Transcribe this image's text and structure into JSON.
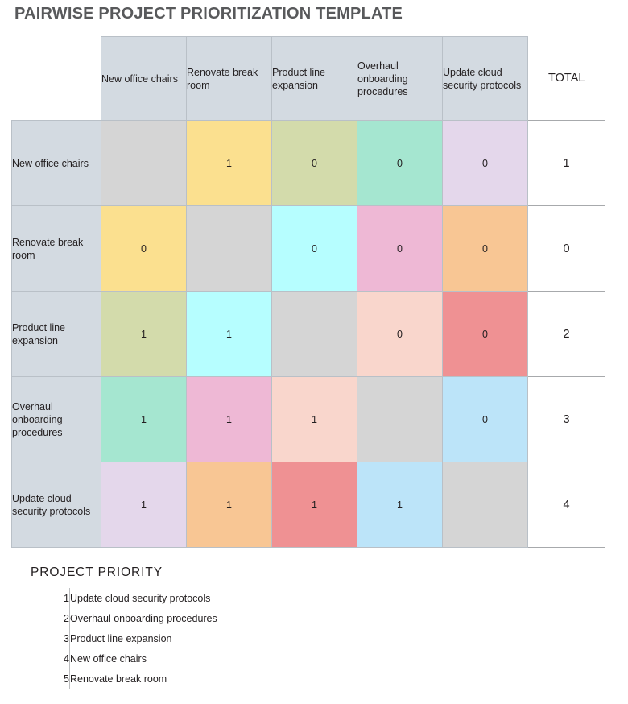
{
  "title": "PAIRWISE PROJECT PRIORITIZATION TEMPLATE",
  "matrix": {
    "total_header": "TOTAL",
    "projects": [
      "New office chairs",
      "Renovate break room",
      "Product line expansion",
      "Overhaul onboarding procedures",
      "Update cloud security protocols"
    ],
    "column_headers": [
      "New office chairs",
      "Renovate break room",
      "Product line expansion",
      "Overhaul onboarding procedures",
      "Update cloud security protocols"
    ],
    "rows": [
      {
        "label": "New office chairs",
        "cells": [
          {
            "value": "",
            "color": "#d5d5d5",
            "diagonal": true
          },
          {
            "value": "1",
            "color": "#fbe08f",
            "diagonal": false
          },
          {
            "value": "0",
            "color": "#d3dbab",
            "diagonal": false
          },
          {
            "value": "0",
            "color": "#a5e6d0",
            "diagonal": false
          },
          {
            "value": "0",
            "color": "#e4d7eb",
            "diagonal": false
          }
        ],
        "total": "1"
      },
      {
        "label": "Renovate break room",
        "cells": [
          {
            "value": "0",
            "color": "#fbe08f",
            "diagonal": false
          },
          {
            "value": "",
            "color": "#d5d5d5",
            "diagonal": true
          },
          {
            "value": "0",
            "color": "#b6feff",
            "diagonal": false
          },
          {
            "value": "0",
            "color": "#eeb8d5",
            "diagonal": false
          },
          {
            "value": "0",
            "color": "#f8c694",
            "diagonal": false
          }
        ],
        "total": "0"
      },
      {
        "label": "Product line expansion",
        "cells": [
          {
            "value": "1",
            "color": "#d3dbab",
            "diagonal": false
          },
          {
            "value": "1",
            "color": "#b6feff",
            "diagonal": false
          },
          {
            "value": "",
            "color": "#d5d5d5",
            "diagonal": true
          },
          {
            "value": "0",
            "color": "#f9d6cc",
            "diagonal": false
          },
          {
            "value": "0",
            "color": "#ef9193",
            "diagonal": false
          }
        ],
        "total": "2"
      },
      {
        "label": "Overhaul onboarding procedures",
        "cells": [
          {
            "value": "1",
            "color": "#a5e6d0",
            "diagonal": false
          },
          {
            "value": "1",
            "color": "#eeb8d5",
            "diagonal": false
          },
          {
            "value": "1",
            "color": "#f9d6cc",
            "diagonal": false
          },
          {
            "value": "",
            "color": "#d5d5d5",
            "diagonal": true
          },
          {
            "value": "0",
            "color": "#bce4f9",
            "diagonal": false
          }
        ],
        "total": "3"
      },
      {
        "label": "Update cloud security protocols",
        "cells": [
          {
            "value": "1",
            "color": "#e4d7eb",
            "diagonal": false
          },
          {
            "value": "1",
            "color": "#f8c694",
            "diagonal": false
          },
          {
            "value": "1",
            "color": "#ef9193",
            "diagonal": false
          },
          {
            "value": "1",
            "color": "#bce4f9",
            "diagonal": false
          },
          {
            "value": "",
            "color": "#d5d5d5",
            "diagonal": true
          }
        ],
        "total": "4"
      }
    ]
  },
  "priority": {
    "heading": "PROJECT PRIORITY",
    "items": [
      {
        "rank": "1",
        "name": "Update cloud security protocols"
      },
      {
        "rank": "2",
        "name": "Overhaul onboarding procedures"
      },
      {
        "rank": "3",
        "name": "Product line expansion"
      },
      {
        "rank": "4",
        "name": "New office chairs"
      },
      {
        "rank": "5",
        "name": "Renovate break room"
      }
    ]
  },
  "colors": {
    "title": "#58595b",
    "header_fill": "#d3dae1",
    "diagonal_fill": "#d5d5d5",
    "grid_line": "#b9c0c7",
    "total_border": "#a7a9ac",
    "text": "#231f20"
  }
}
